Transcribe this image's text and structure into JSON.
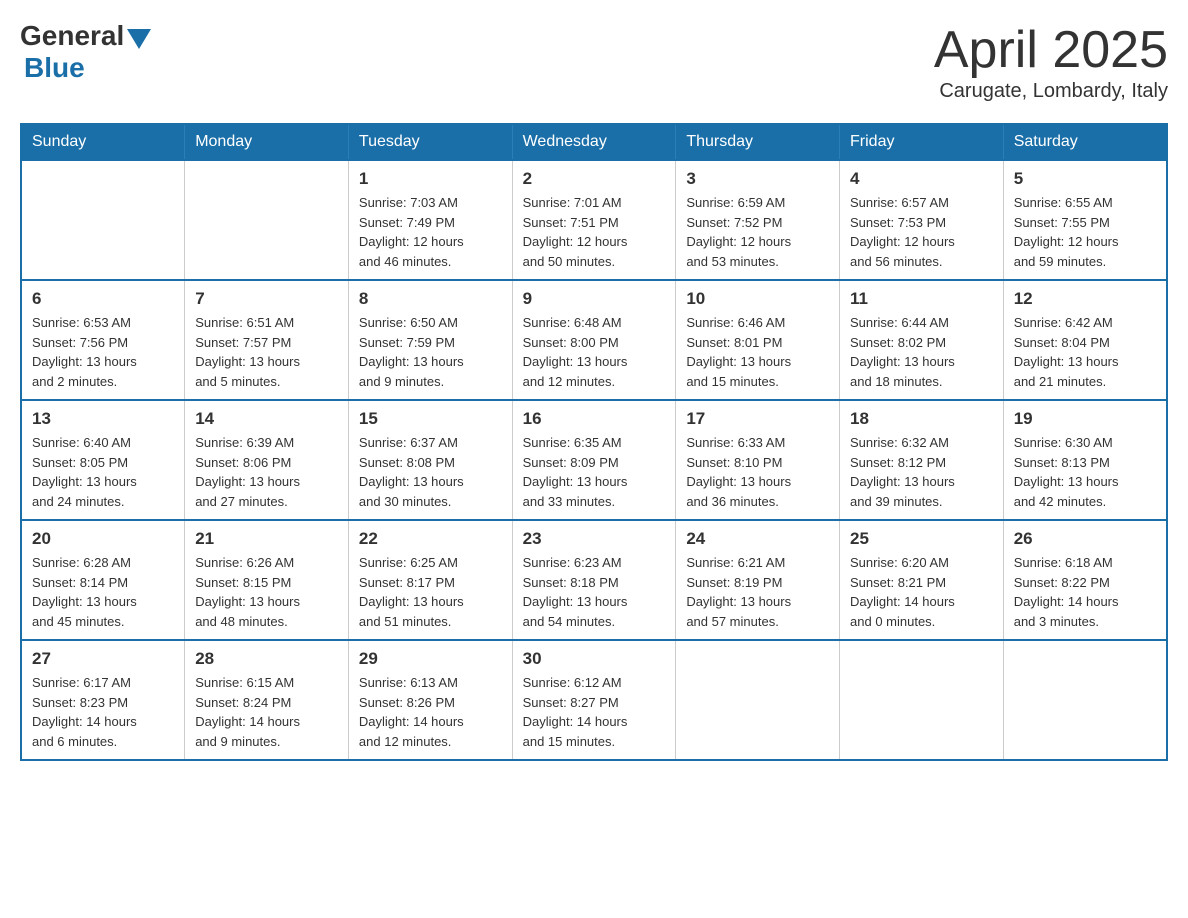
{
  "header": {
    "logo": {
      "general": "General",
      "blue": "Blue"
    },
    "title": "April 2025",
    "location": "Carugate, Lombardy, Italy"
  },
  "weekdays": [
    "Sunday",
    "Monday",
    "Tuesday",
    "Wednesday",
    "Thursday",
    "Friday",
    "Saturday"
  ],
  "weeks": [
    [
      {
        "day": "",
        "info": ""
      },
      {
        "day": "",
        "info": ""
      },
      {
        "day": "1",
        "info": "Sunrise: 7:03 AM\nSunset: 7:49 PM\nDaylight: 12 hours\nand 46 minutes."
      },
      {
        "day": "2",
        "info": "Sunrise: 7:01 AM\nSunset: 7:51 PM\nDaylight: 12 hours\nand 50 minutes."
      },
      {
        "day": "3",
        "info": "Sunrise: 6:59 AM\nSunset: 7:52 PM\nDaylight: 12 hours\nand 53 minutes."
      },
      {
        "day": "4",
        "info": "Sunrise: 6:57 AM\nSunset: 7:53 PM\nDaylight: 12 hours\nand 56 minutes."
      },
      {
        "day": "5",
        "info": "Sunrise: 6:55 AM\nSunset: 7:55 PM\nDaylight: 12 hours\nand 59 minutes."
      }
    ],
    [
      {
        "day": "6",
        "info": "Sunrise: 6:53 AM\nSunset: 7:56 PM\nDaylight: 13 hours\nand 2 minutes."
      },
      {
        "day": "7",
        "info": "Sunrise: 6:51 AM\nSunset: 7:57 PM\nDaylight: 13 hours\nand 5 minutes."
      },
      {
        "day": "8",
        "info": "Sunrise: 6:50 AM\nSunset: 7:59 PM\nDaylight: 13 hours\nand 9 minutes."
      },
      {
        "day": "9",
        "info": "Sunrise: 6:48 AM\nSunset: 8:00 PM\nDaylight: 13 hours\nand 12 minutes."
      },
      {
        "day": "10",
        "info": "Sunrise: 6:46 AM\nSunset: 8:01 PM\nDaylight: 13 hours\nand 15 minutes."
      },
      {
        "day": "11",
        "info": "Sunrise: 6:44 AM\nSunset: 8:02 PM\nDaylight: 13 hours\nand 18 minutes."
      },
      {
        "day": "12",
        "info": "Sunrise: 6:42 AM\nSunset: 8:04 PM\nDaylight: 13 hours\nand 21 minutes."
      }
    ],
    [
      {
        "day": "13",
        "info": "Sunrise: 6:40 AM\nSunset: 8:05 PM\nDaylight: 13 hours\nand 24 minutes."
      },
      {
        "day": "14",
        "info": "Sunrise: 6:39 AM\nSunset: 8:06 PM\nDaylight: 13 hours\nand 27 minutes."
      },
      {
        "day": "15",
        "info": "Sunrise: 6:37 AM\nSunset: 8:08 PM\nDaylight: 13 hours\nand 30 minutes."
      },
      {
        "day": "16",
        "info": "Sunrise: 6:35 AM\nSunset: 8:09 PM\nDaylight: 13 hours\nand 33 minutes."
      },
      {
        "day": "17",
        "info": "Sunrise: 6:33 AM\nSunset: 8:10 PM\nDaylight: 13 hours\nand 36 minutes."
      },
      {
        "day": "18",
        "info": "Sunrise: 6:32 AM\nSunset: 8:12 PM\nDaylight: 13 hours\nand 39 minutes."
      },
      {
        "day": "19",
        "info": "Sunrise: 6:30 AM\nSunset: 8:13 PM\nDaylight: 13 hours\nand 42 minutes."
      }
    ],
    [
      {
        "day": "20",
        "info": "Sunrise: 6:28 AM\nSunset: 8:14 PM\nDaylight: 13 hours\nand 45 minutes."
      },
      {
        "day": "21",
        "info": "Sunrise: 6:26 AM\nSunset: 8:15 PM\nDaylight: 13 hours\nand 48 minutes."
      },
      {
        "day": "22",
        "info": "Sunrise: 6:25 AM\nSunset: 8:17 PM\nDaylight: 13 hours\nand 51 minutes."
      },
      {
        "day": "23",
        "info": "Sunrise: 6:23 AM\nSunset: 8:18 PM\nDaylight: 13 hours\nand 54 minutes."
      },
      {
        "day": "24",
        "info": "Sunrise: 6:21 AM\nSunset: 8:19 PM\nDaylight: 13 hours\nand 57 minutes."
      },
      {
        "day": "25",
        "info": "Sunrise: 6:20 AM\nSunset: 8:21 PM\nDaylight: 14 hours\nand 0 minutes."
      },
      {
        "day": "26",
        "info": "Sunrise: 6:18 AM\nSunset: 8:22 PM\nDaylight: 14 hours\nand 3 minutes."
      }
    ],
    [
      {
        "day": "27",
        "info": "Sunrise: 6:17 AM\nSunset: 8:23 PM\nDaylight: 14 hours\nand 6 minutes."
      },
      {
        "day": "28",
        "info": "Sunrise: 6:15 AM\nSunset: 8:24 PM\nDaylight: 14 hours\nand 9 minutes."
      },
      {
        "day": "29",
        "info": "Sunrise: 6:13 AM\nSunset: 8:26 PM\nDaylight: 14 hours\nand 12 minutes."
      },
      {
        "day": "30",
        "info": "Sunrise: 6:12 AM\nSunset: 8:27 PM\nDaylight: 14 hours\nand 15 minutes."
      },
      {
        "day": "",
        "info": ""
      },
      {
        "day": "",
        "info": ""
      },
      {
        "day": "",
        "info": ""
      }
    ]
  ]
}
